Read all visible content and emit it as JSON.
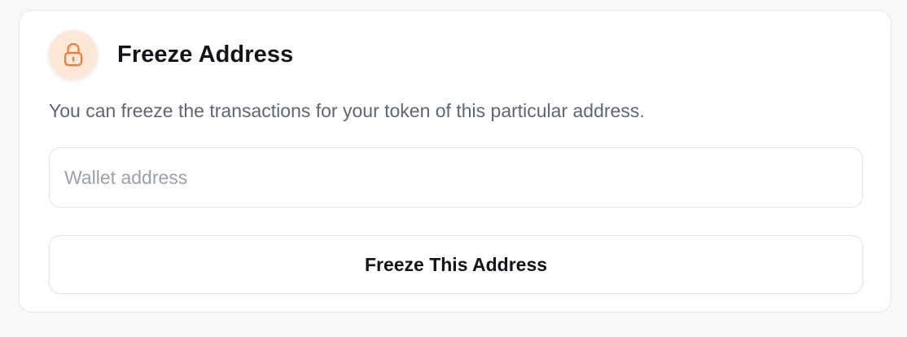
{
  "card": {
    "title": "Freeze Address",
    "icon": "unlock-icon",
    "accent_color": "#f07a3a",
    "description": "You can freeze the transactions for your token of this particular address.",
    "wallet_input": {
      "placeholder": "Wallet address",
      "value": ""
    },
    "submit_label": "Freeze This Address"
  }
}
